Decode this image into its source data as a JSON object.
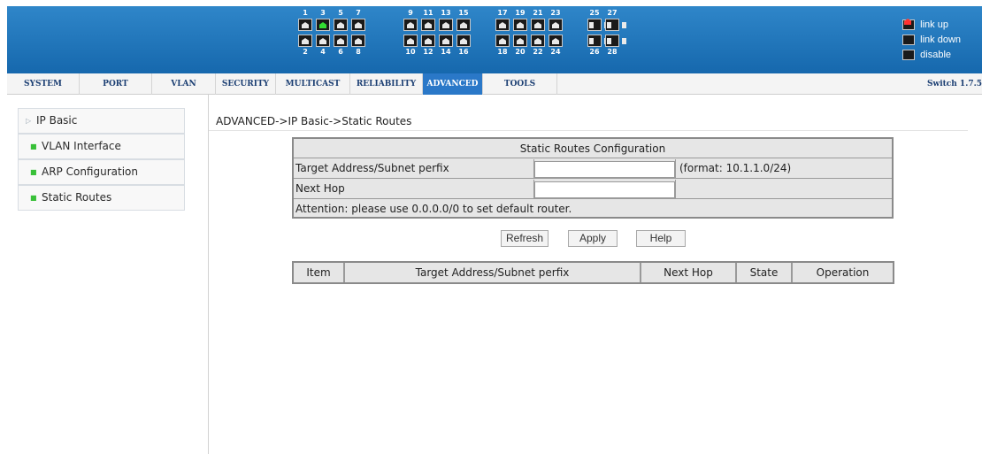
{
  "header": {
    "port_groups": [
      {
        "top": [
          "1",
          "3",
          "5",
          "7"
        ],
        "bottom": [
          "2",
          "4",
          "6",
          "8"
        ],
        "up": [
          "3"
        ]
      },
      {
        "top": [
          "9",
          "11",
          "13",
          "15"
        ],
        "bottom": [
          "10",
          "12",
          "14",
          "16"
        ],
        "up": []
      },
      {
        "top": [
          "17",
          "19",
          "21",
          "23"
        ],
        "bottom": [
          "18",
          "20",
          "22",
          "24"
        ],
        "up": []
      },
      {
        "top": [
          "25",
          "27"
        ],
        "bottom": [
          "26",
          "28"
        ],
        "up": [],
        "sfp": true
      }
    ],
    "legend": {
      "link_up": "link up",
      "link_down": "link down",
      "disable": "disable"
    },
    "colors": {
      "header_blue": "#1f78c0",
      "link_up": "#33dd33",
      "disable": "#ff3030",
      "active_tab": "#2a78c8"
    }
  },
  "menu": {
    "items": [
      "SYSTEM",
      "PORT",
      "VLAN",
      "SECURITY",
      "MULTICAST",
      "RELIABILITY",
      "ADVANCED",
      "TOOLS"
    ],
    "active": "ADVANCED",
    "version": "Switch 1.7.5"
  },
  "sidebar": {
    "items": [
      {
        "label": "IP Basic",
        "icon": "arrow-right-icon"
      },
      {
        "label": "VLAN Interface",
        "icon": "green-square-icon"
      },
      {
        "label": "ARP Configuration",
        "icon": "green-square-icon"
      },
      {
        "label": "Static Routes",
        "icon": "green-square-icon"
      }
    ]
  },
  "main": {
    "breadcrumb": "ADVANCED->IP Basic->Static Routes",
    "config": {
      "title": "Static Routes Configuration",
      "target_label": "Target Address/Subnet perfix",
      "target_value": "",
      "target_hint": "(format: 10.1.1.0/24)",
      "nexthop_label": "Next Hop",
      "nexthop_value": "",
      "attention": "Attention: please use 0.0.0.0/0 to set default router."
    },
    "buttons": {
      "refresh": "Refresh",
      "apply": "Apply",
      "help": "Help"
    },
    "table": {
      "columns": [
        "Item",
        "Target Address/Subnet perfix",
        "Next Hop",
        "State",
        "Operation"
      ],
      "rows": []
    }
  }
}
